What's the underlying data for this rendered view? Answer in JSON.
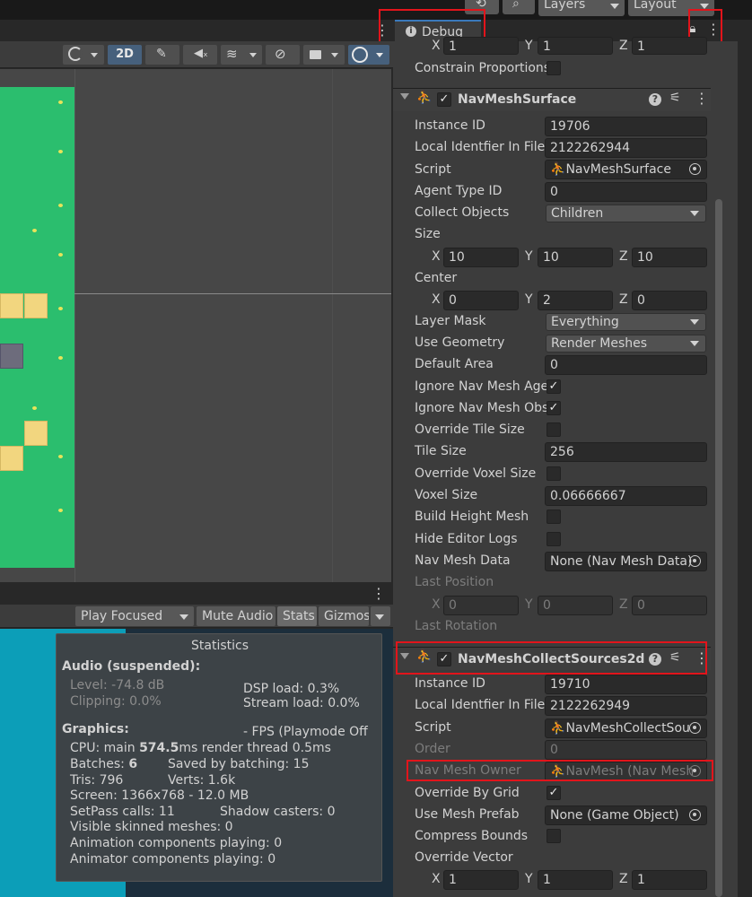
{
  "topbar": {
    "layers_label": "Layers",
    "layout_label": "Layout"
  },
  "inspector_tab": {
    "label": "Debug"
  },
  "scene_toolbar": {
    "mode_2d": "2D"
  },
  "game_toolbar": {
    "play_focused": "Play Focused",
    "mute_audio": "Mute Audio",
    "stats": "Stats",
    "gizmos": "Gizmos"
  },
  "stats": {
    "title": "Statistics",
    "audio_header": "Audio (suspended):",
    "level": "Level: -74.8 dB",
    "clipping": "Clipping: 0.0%",
    "dsp_load": "DSP load: 0.3%",
    "stream_load": "Stream load: 0.0%",
    "graphics_header": "Graphics:",
    "fps": "- FPS (Playmode Off",
    "cpu_prefix": "CPU: main ",
    "cpu_main": "574.5",
    "cpu_suffix": "ms  render thread 0.5ms",
    "batches_prefix": "Batches: ",
    "batches": "6",
    "saved_batching": "Saved by batching: 15",
    "tris": "Tris: 796",
    "verts": "Verts: 1.6k",
    "screen": "Screen: 1366x768 - 12.0 MB",
    "setpass": "SetPass calls: 11",
    "shadow_casters": "Shadow casters: 0",
    "skinned": "Visible skinned meshes: 0",
    "anim_components": "Animation components playing: 0",
    "animator_components": "Animator components playing: 0"
  },
  "transform_partial": {
    "scale_x_axis": "X",
    "scale_x": "1",
    "scale_y_axis": "Y",
    "scale_y": "1",
    "scale_z_axis": "Z",
    "scale_z": "1",
    "constrain_label": "Constrain Proportions"
  },
  "navmesh_surface": {
    "title": "NavMeshSurface",
    "instance_id_label": "Instance ID",
    "instance_id": "19706",
    "local_id_label": "Local Identfier In File",
    "local_id": "2122262944",
    "script_label": "Script",
    "script": "NavMeshSurface",
    "agent_type_label": "Agent Type ID",
    "agent_type": "0",
    "collect_label": "Collect Objects",
    "collect": "Children",
    "size_label": "Size",
    "size_x": "10",
    "size_y": "10",
    "size_z": "10",
    "center_label": "Center",
    "center_x": "0",
    "center_y": "2",
    "center_z": "0",
    "layer_mask_label": "Layer Mask",
    "layer_mask": "Everything",
    "use_geometry_label": "Use Geometry",
    "use_geometry": "Render Meshes",
    "default_area_label": "Default Area",
    "default_area": "0",
    "ignore_agents_label": "Ignore Nav Mesh Age",
    "ignore_obstacles_label": "Ignore Nav Mesh Obs",
    "override_tile_label": "Override Tile Size",
    "tile_size_label": "Tile Size",
    "tile_size": "256",
    "override_voxel_label": "Override Voxel Size",
    "voxel_size_label": "Voxel Size",
    "voxel_size": "0.06666667",
    "build_height_label": "Build Height Mesh",
    "hide_logs_label": "Hide Editor Logs",
    "nav_data_label": "Nav Mesh Data",
    "nav_data": "None (Nav Mesh Data)",
    "last_position_label": "Last Position",
    "last_pos_x": "0",
    "last_pos_y": "0",
    "last_pos_z": "0",
    "last_rotation_label": "Last Rotation"
  },
  "navmesh_collect": {
    "title": "NavMeshCollectSources2d",
    "instance_id_label": "Instance ID",
    "instance_id": "19710",
    "local_id_label": "Local Identfier In File",
    "local_id": "2122262949",
    "script_label": "Script",
    "script": "NavMeshCollectSou",
    "order_label": "Order",
    "order": "0",
    "owner_label": "Nav Mesh Owner",
    "owner": "NavMesh (Nav Mesh",
    "override_grid_label": "Override By Grid",
    "mesh_prefab_label": "Use Mesh Prefab",
    "mesh_prefab": "None (Game Object)",
    "compress_label": "Compress Bounds",
    "override_vector_label": "Override Vector",
    "vec_x": "1",
    "vec_y": "1",
    "vec_z": "1"
  },
  "axes": {
    "x": "X",
    "y": "Y",
    "z": "Z"
  },
  "checkmark": "✓",
  "colors": {
    "accent": "#3a79bb",
    "highlight_red": "#e2141b",
    "grass": "#2bbe6e",
    "game_bg": "#0c9eb8"
  }
}
